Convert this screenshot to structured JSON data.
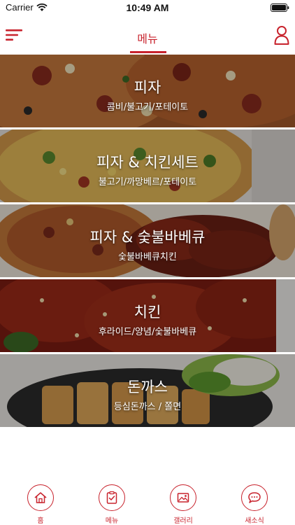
{
  "status_bar": {
    "carrier": "Carrier",
    "time": "10:49 AM"
  },
  "nav": {
    "title": "메뉴",
    "left_icon": "hamburger-menu-icon",
    "right_icon": "user-profile-icon"
  },
  "menu_items": [
    {
      "title": "피자",
      "subtitle": "콤비/불고기/포테이토",
      "image": "pizza-photo"
    },
    {
      "title": "피자 & 치킨세트",
      "subtitle": "불고기/까망베르/포테이토",
      "image": "pizza-photo"
    },
    {
      "title": "피자 & 숯불바베큐",
      "subtitle": "숯불바베큐치킨",
      "image": "pizza-bbq-chicken-photo"
    },
    {
      "title": "치킨",
      "subtitle": "후라이드/양념/숯불바베큐",
      "image": "fried-chicken-photo"
    },
    {
      "title": "돈까스",
      "subtitle": "등심돈까스 / 쫄면",
      "image": "tonkatsu-photo"
    }
  ],
  "tabs": [
    {
      "label": "홈",
      "icon": "home-icon"
    },
    {
      "label": "메뉴",
      "icon": "menu-clipboard-icon"
    },
    {
      "label": "갤러리",
      "icon": "gallery-icon"
    },
    {
      "label": "새소식",
      "icon": "news-chat-icon"
    }
  ],
  "colors": {
    "accent": "#c8232d",
    "background": "#ffffff"
  }
}
